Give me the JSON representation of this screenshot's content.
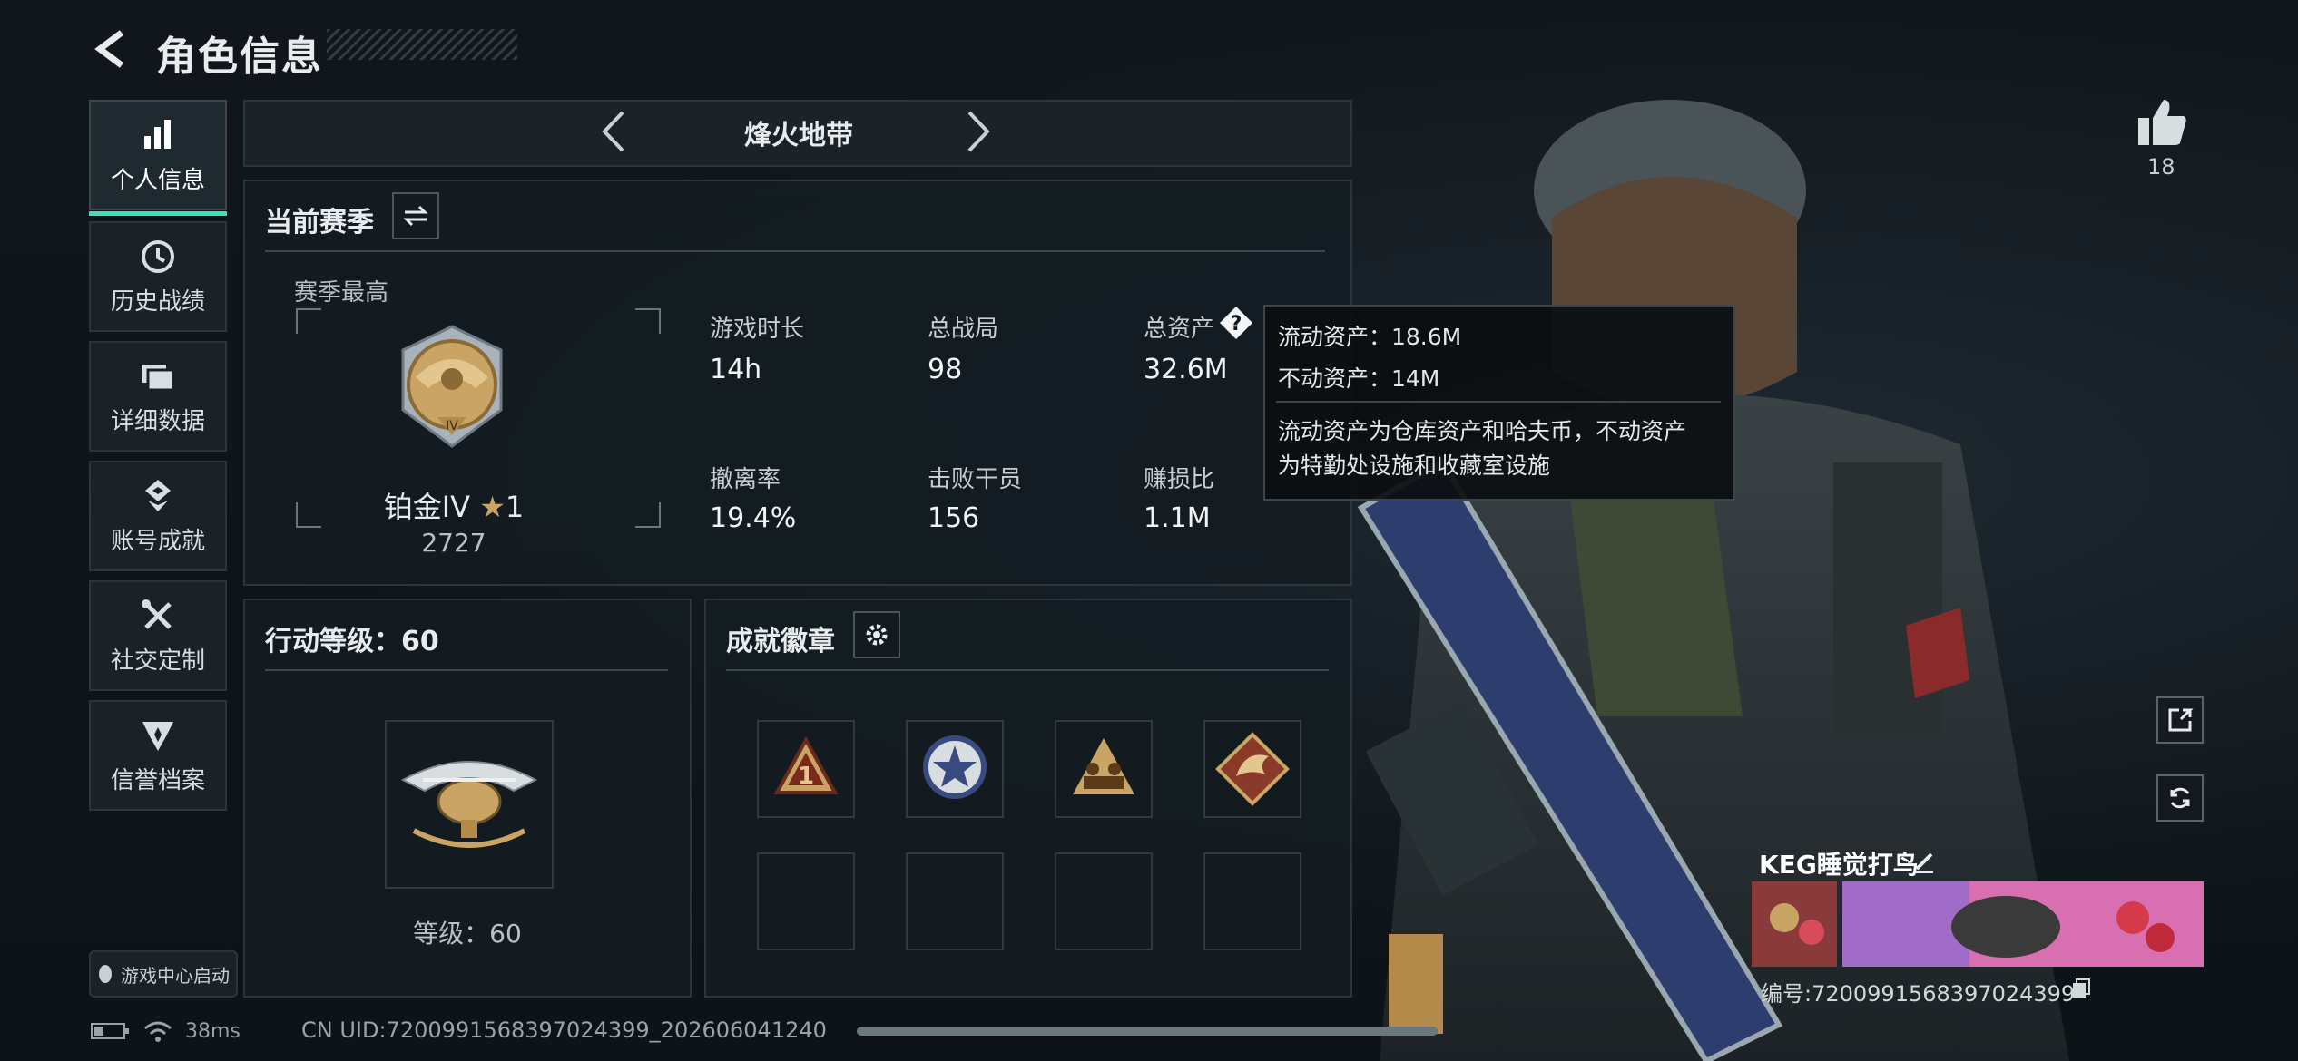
{
  "header": {
    "title": "角色信息"
  },
  "sidebar": {
    "items": [
      {
        "label": "个人信息",
        "icon": "bar-chart-icon",
        "active": true
      },
      {
        "label": "历史战绩",
        "icon": "clock-icon"
      },
      {
        "label": "详细数据",
        "icon": "folder-icon"
      },
      {
        "label": "账号成就",
        "icon": "achievement-icon"
      },
      {
        "label": "社交定制",
        "icon": "tools-icon"
      },
      {
        "label": "信誉档案",
        "icon": "shield-badge-icon"
      }
    ],
    "launcher": "游戏中心启动"
  },
  "mode": {
    "title": "烽火地带"
  },
  "season": {
    "title": "当前赛季",
    "best_label": "赛季最高",
    "rank_name": "铂金IV",
    "rank_stars": "1",
    "rank_score": "2727",
    "stats": [
      {
        "label": "游戏时长",
        "value": "14h"
      },
      {
        "label": "总战局",
        "value": "98"
      },
      {
        "label": "总资产",
        "value": "32.6M"
      },
      {
        "label": "撤离率",
        "value": "19.4%"
      },
      {
        "label": "击败干员",
        "value": "156"
      },
      {
        "label": "赚损比",
        "value": "1.1M"
      }
    ]
  },
  "tooltip": {
    "line1": "流动资产：18.6M",
    "line2": "不动资产：14M",
    "desc1": "流动资产为仓库资产和哈夫币，不动资产",
    "desc2": "为特勤处设施和收藏室设施"
  },
  "action": {
    "title": "行动等级：60",
    "level_label": "等级：60"
  },
  "badges": {
    "title": "成就徽章"
  },
  "status": {
    "ping": "38ms",
    "uid": "CN UID:7200991568397024399_202606041240"
  },
  "player": {
    "likes": "18",
    "name": "KEG睡觉打鸟",
    "id": "编号:7200991568397024399"
  },
  "colors": {
    "accent": "#3de0b9",
    "gold": "#c9a465",
    "bg": "#10161b"
  }
}
